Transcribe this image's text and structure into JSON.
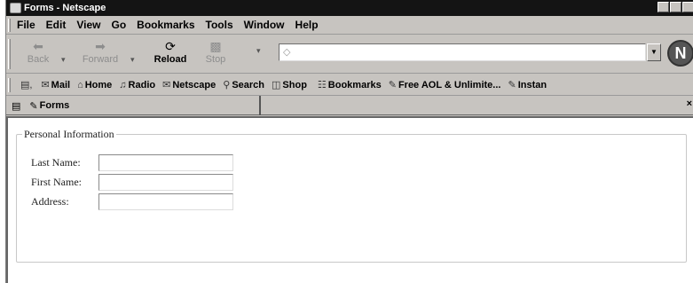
{
  "window": {
    "title": "Forms - Netscape"
  },
  "menubar": {
    "items": [
      "File",
      "Edit",
      "View",
      "Go",
      "Bookmarks",
      "Tools",
      "Window",
      "Help"
    ]
  },
  "navbar": {
    "back": "Back",
    "forward": "Forward",
    "reload": "Reload",
    "stop": "Stop",
    "url_value": "",
    "logo": "N"
  },
  "personal_toolbar": {
    "items": [
      "Mail",
      "Home",
      "Radio",
      "Netscape",
      "Search",
      "Shop",
      "Bookmarks",
      "Free AOL & Unlimite...",
      "Instan"
    ]
  },
  "tabs": {
    "active": "Forms",
    "close": "×"
  },
  "form": {
    "legend": "Personal Information",
    "fields": [
      {
        "label": "Last Name:",
        "value": ""
      },
      {
        "label": "First Name:",
        "value": ""
      },
      {
        "label": "Address:",
        "value": ""
      }
    ]
  }
}
